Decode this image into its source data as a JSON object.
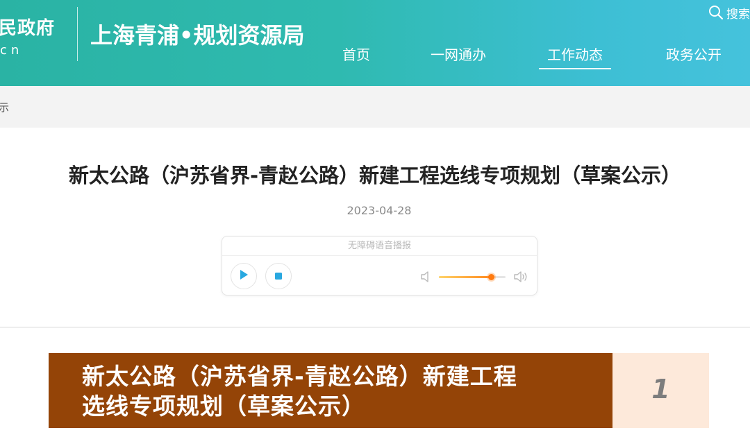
{
  "header": {
    "gov_name_partial": "民政府",
    "gov_domain_partial": "cn",
    "bureau_title": "上海青浦•规划资源局",
    "search_label": "搜索",
    "nav": [
      {
        "label": "首页",
        "active": false
      },
      {
        "label": "一网通办",
        "active": false
      },
      {
        "label": "工作动态",
        "active": true
      },
      {
        "label": "政务公开",
        "active": false
      }
    ]
  },
  "breadcrumb": {
    "text_partial": "示"
  },
  "article": {
    "title": "新太公路（沪苏省界-青赵公路）新建工程选线专项规划（草案公示）",
    "date": "2023-04-28"
  },
  "player": {
    "label": "无障碍语音播报",
    "volume_percent": 78,
    "colors": {
      "accent": "#29a8e0",
      "volume": "#ff8a1e"
    }
  },
  "content": {
    "banner_line1": "新太公路（沪苏省界-青赵公路）新建工程",
    "banner_line2": "选线专项规划（草案公示）",
    "page_number": "1",
    "colors": {
      "banner_bg": "#944407",
      "page_box_bg": "#fde9da"
    }
  }
}
